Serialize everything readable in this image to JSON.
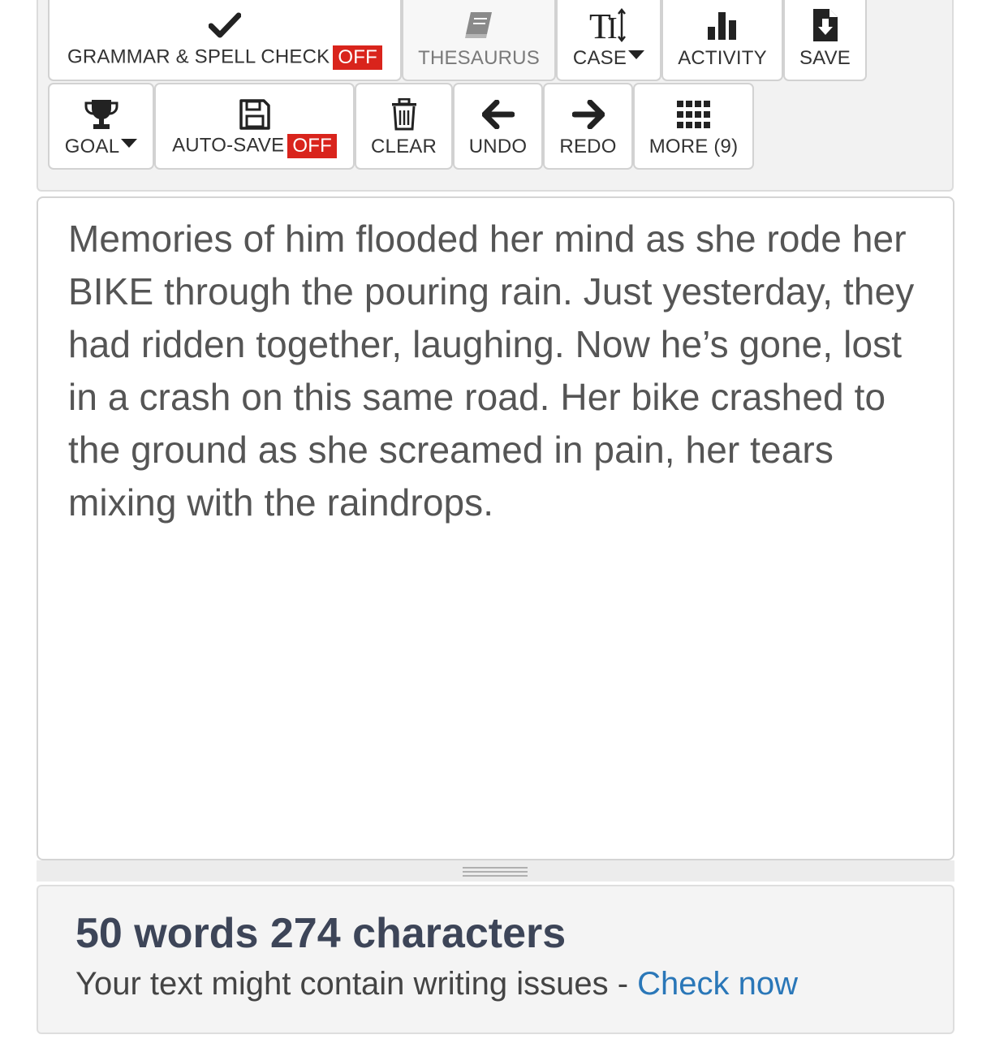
{
  "toolbar": {
    "row1": [
      {
        "icon": "checkmark-icon",
        "label": "GRAMMAR & SPELL CHECK",
        "badge": "OFF"
      },
      {
        "icon": "book-icon",
        "label": "THESAURUS"
      },
      {
        "icon": "text-case-icon",
        "label": "CASE"
      },
      {
        "icon": "bar-chart-icon",
        "label": "ACTIVITY"
      },
      {
        "icon": "file-download-icon",
        "label": "SAVE"
      }
    ],
    "row2": [
      {
        "icon": "trophy-icon",
        "label": "GOAL"
      },
      {
        "icon": "floppy-disk-icon",
        "label": "AUTO-SAVE",
        "badge": "OFF"
      },
      {
        "icon": "trash-icon",
        "label": "CLEAR"
      },
      {
        "icon": "arrow-left-icon",
        "label": "UNDO"
      },
      {
        "icon": "arrow-right-icon",
        "label": "REDO"
      },
      {
        "icon": "grid-icon",
        "label": "MORE (9)"
      }
    ]
  },
  "editor": {
    "text": "Memories of him flooded her mind as she rode her BIKE through the pouring rain. Just yesterday, they had ridden together, laughing. Now he’s gone, lost in a crash on this same road. Her bike crashed to the ground as she screamed in pain, her tears mixing with the raindrops."
  },
  "stats": {
    "words": "50 words",
    "characters": "274 characters",
    "note": "Your text might contain writing issues - ",
    "link": "Check now"
  },
  "colors": {
    "badge": "#d9241c",
    "link": "#2a77b8",
    "stats_text": "#3d4558"
  }
}
